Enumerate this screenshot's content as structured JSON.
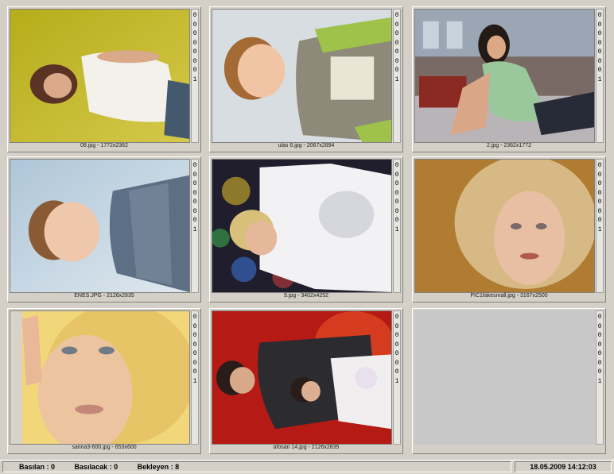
{
  "tiles": [
    {
      "caption": "08.jpg  -  1772x2362",
      "counter": [
        "0",
        "0",
        "0",
        "0",
        "0",
        "0",
        "0",
        "1"
      ],
      "subject": "woman-white-top-green-background"
    },
    {
      "caption": "ulas 6.jpg  -  2067x2894",
      "counter": [
        "0",
        "0",
        "0",
        "0",
        "0",
        "0",
        "0",
        "1"
      ],
      "subject": "boy-striped-sweater"
    },
    {
      "caption": "2.jpg  -  2362x1772",
      "counter": [
        "0",
        "0",
        "0",
        "0",
        "0",
        "0",
        "0",
        "1"
      ],
      "subject": "woman-green-top-sitting"
    },
    {
      "caption": "ENES.JPG  -  2126x2835",
      "counter": [
        "0",
        "0",
        "0",
        "0",
        "0",
        "0",
        "0",
        "1"
      ],
      "subject": "boy-plaid-shirt"
    },
    {
      "caption": "9.jpg  -  3402x4252",
      "counter": [
        "0",
        "0",
        "0",
        "0",
        "0",
        "0",
        "0",
        "1"
      ],
      "subject": "bride-colorful-lights"
    },
    {
      "caption": "PIC1fakesmall.jpg  -  3167x2500",
      "counter": [
        "0",
        "0",
        "0",
        "0",
        "0",
        "0",
        "0",
        "1"
      ],
      "subject": "blonde-woman-portrait"
    },
    {
      "caption": "sarina3-600.jpg  -  653x600",
      "counter": [
        "0",
        "0",
        "0",
        "0",
        "0",
        "0",
        "0",
        "1"
      ],
      "subject": "blonde-woman-yellow"
    },
    {
      "caption": "afosan 14.jpg  -  2126x2835",
      "counter": [
        "0",
        "0",
        "0",
        "0",
        "0",
        "0",
        "0",
        "1"
      ],
      "subject": "wedding-couple-red"
    },
    {
      "caption": "",
      "counter": [
        "0",
        "0",
        "0",
        "0",
        "0",
        "0",
        "0",
        "1"
      ],
      "subject": "empty"
    }
  ],
  "status": {
    "basilan": "Basılan : 0",
    "basilacak": "Basılacak : 0",
    "bekleyen": "Bekleyen : 8",
    "datetime": "18.05.2009 14:12:03"
  }
}
